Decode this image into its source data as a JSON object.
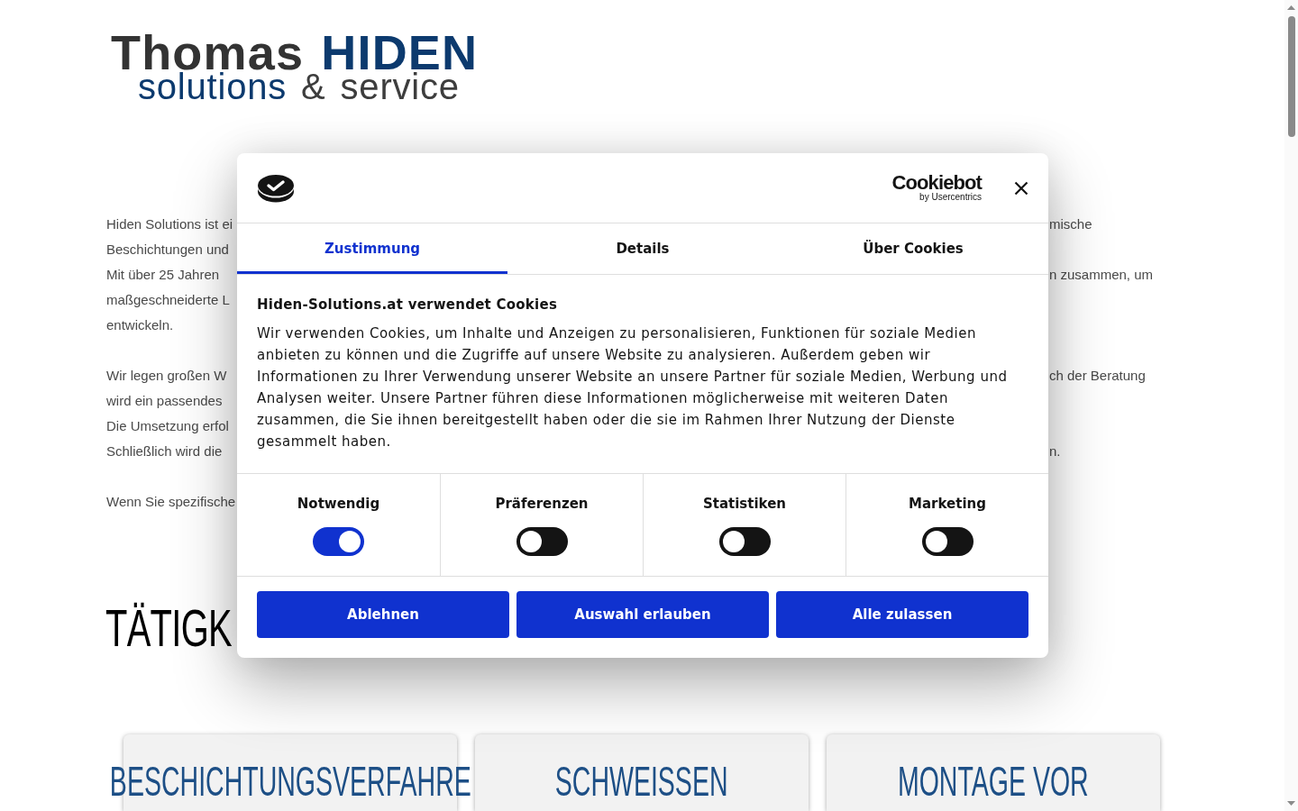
{
  "page": {
    "logo": {
      "name_parts": [
        {
          "text": "Thomas",
          "color": "#333333"
        },
        {
          "text": "HIDEN",
          "color": "#0c3a6e"
        }
      ],
      "tagline_parts": [
        {
          "text": "solutions",
          "color": "#0c3a6e"
        },
        {
          "text": "&",
          "color": "#3d3d3d"
        },
        {
          "text": "service",
          "color": "#3d3d3d"
        }
      ]
    },
    "intro": {
      "paragraphs": [
        {
          "lines": [
            {
              "start": "Hiden Solutions ist ei",
              "end": "mische"
            },
            {
              "start": "Beschichtungen und"
            },
            {
              "start": "Mit über 25 Jahren",
              "end": "n zusammen, um"
            },
            {
              "start": "maßgeschneiderte L"
            },
            {
              "start": "entwickeln."
            }
          ]
        },
        {
          "lines": [
            {
              "start": "Wir legen großen W",
              "end": "ch der Beratung"
            },
            {
              "start": "wird ein passendes"
            },
            {
              "start": "Die Umsetzung erfol"
            },
            {
              "start": "Schließlich wird die",
              "end": "n."
            }
          ]
        },
        {
          "lines": [
            {
              "start": "Wenn Sie spezifische"
            }
          ]
        }
      ]
    },
    "section_heading": "TÄTIGK",
    "service_cards": [
      {
        "title": "BESCHICHTUNGSVERFAHRE"
      },
      {
        "title": "SCHWEISSEN"
      },
      {
        "title": "MONTAGE VOR"
      }
    ]
  },
  "cookie_dialog": {
    "brand": {
      "name": "Cookiebot",
      "tagline": "by Usercentrics"
    },
    "tabs": [
      {
        "label": "Zustimmung",
        "selected": true
      },
      {
        "label": "Details",
        "selected": false
      },
      {
        "label": "Über Cookies",
        "selected": false
      }
    ],
    "title": "Hiden-Solutions.at verwendet Cookies",
    "text": "Wir verwenden Cookies, um Inhalte und Anzeigen zu personalisieren, Funktionen für soziale Medien anbieten zu können und die Zugriffe auf unsere Website zu analysieren. Außerdem geben wir Informationen zu Ihrer Verwendung unserer Website an unsere Partner für soziale Medien, Werbung und Analysen weiter. Unsere Partner führen diese Informationen möglicherweise mit weiteren Daten zusammen, die Sie ihnen bereitgestellt haben oder die sie im Rahmen Ihrer Nutzung der Dienste gesammelt haben.",
    "categories": [
      {
        "label": "Notwendig",
        "on": true
      },
      {
        "label": "Präferenzen",
        "on": false
      },
      {
        "label": "Statistiken",
        "on": false
      },
      {
        "label": "Marketing",
        "on": false
      }
    ],
    "buttons": [
      "Ablehnen",
      "Auswahl erlauben",
      "Alle zulassen"
    ]
  }
}
